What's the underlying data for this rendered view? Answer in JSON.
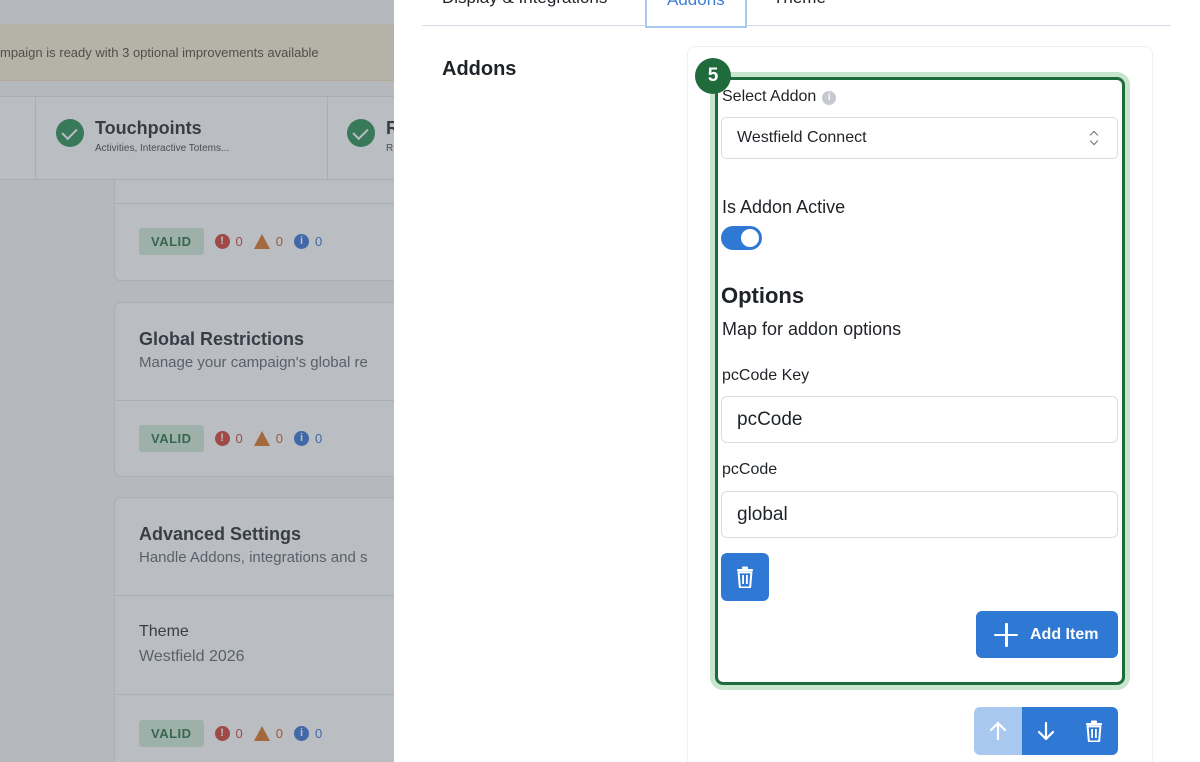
{
  "background": {
    "banner_text": "mpaign is ready with 3 optional improvements available",
    "steps": [
      {
        "title": "Touchpoints",
        "subtitle": "Activities, Interactive Totems..."
      },
      {
        "title": "R",
        "subtitle": "R"
      }
    ],
    "cards": {
      "first": {
        "status": "VALID",
        "errors": "0",
        "warnings": "0",
        "infos": "0"
      },
      "global_restrictions": {
        "title": "Global Restrictions",
        "subtitle": "Manage your campaign's global re",
        "status": "VALID",
        "errors": "0",
        "warnings": "0",
        "infos": "0"
      },
      "advanced_settings": {
        "title": "Advanced Settings",
        "subtitle": "Handle Addons, integrations and s",
        "theme_label": "Theme",
        "theme_value": "Westfield 2026",
        "status": "VALID",
        "errors": "0",
        "warnings": "0",
        "infos": "0"
      }
    }
  },
  "drawer": {
    "tabs": [
      "Display & Integrations",
      "Addons",
      "Theme"
    ],
    "active_tab": "Addons",
    "section_label": "Addons",
    "addon": {
      "index_badge": "5",
      "select_label": "Select Addon",
      "select_value": "Westfield Connect",
      "active_label": "Is Addon Active",
      "active": true,
      "options_title": "Options",
      "options_subtitle": "Map for addon options",
      "fields": [
        {
          "label": "pcCode Key",
          "value": "pcCode"
        },
        {
          "label": "pcCode",
          "value": "global"
        }
      ],
      "add_item_label": "Add Item"
    }
  },
  "colors": {
    "primary": "#2f78d4",
    "success_dark": "#1f6b3b",
    "valid_bg": "#cfe9d6",
    "error": "#d33a2c",
    "warning": "#d9701b",
    "info": "#2f6fd0",
    "banner_bg": "#f7edd0"
  },
  "icons": [
    "check-icon",
    "error-icon",
    "warning-icon",
    "info-icon",
    "chevron-updown-icon",
    "trash-icon",
    "plus-icon",
    "arrow-up-icon",
    "arrow-down-icon"
  ]
}
